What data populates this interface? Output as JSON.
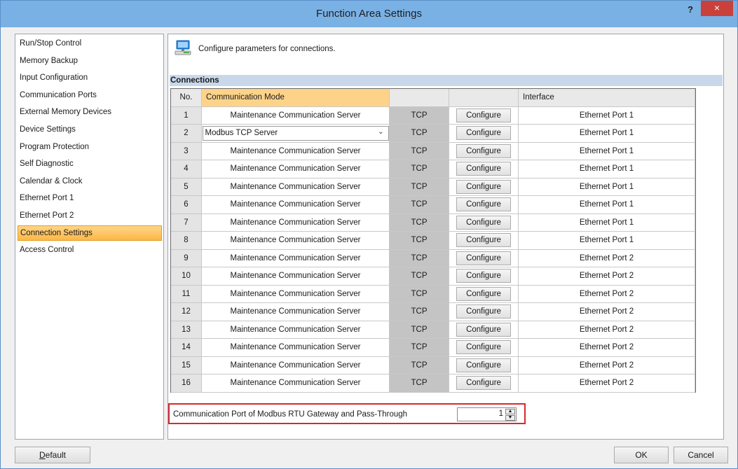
{
  "window": {
    "title": "Function Area Settings",
    "help": "?",
    "close": "×"
  },
  "sidebar": {
    "items": [
      "Run/Stop Control",
      "Memory Backup",
      "Input Configuration",
      "Communication Ports",
      "External Memory Devices",
      "Device Settings",
      "Program Protection",
      "Self Diagnostic",
      "Calendar & Clock",
      "Ethernet Port 1",
      "Ethernet Port 2",
      "Connection Settings",
      "Access Control"
    ],
    "selected_index": 11
  },
  "header": {
    "description": "Configure parameters for connections."
  },
  "connections": {
    "section_title": "Connections",
    "columns": {
      "no": "No.",
      "mode": "Communication Mode",
      "protocol": "",
      "configure": "",
      "interface": "Interface"
    },
    "rows": [
      {
        "no": "1",
        "mode": "Maintenance Communication Server",
        "protocol": "TCP",
        "configure": "Configure",
        "interface": "Ethernet Port 1"
      },
      {
        "no": "2",
        "mode": "Modbus TCP Server",
        "protocol": "TCP",
        "configure": "Configure",
        "interface": "Ethernet Port 1",
        "dropdown": true
      },
      {
        "no": "3",
        "mode": "Maintenance Communication Server",
        "protocol": "TCP",
        "configure": "Configure",
        "interface": "Ethernet Port 1"
      },
      {
        "no": "4",
        "mode": "Maintenance Communication Server",
        "protocol": "TCP",
        "configure": "Configure",
        "interface": "Ethernet Port 1"
      },
      {
        "no": "5",
        "mode": "Maintenance Communication Server",
        "protocol": "TCP",
        "configure": "Configure",
        "interface": "Ethernet Port 1"
      },
      {
        "no": "6",
        "mode": "Maintenance Communication Server",
        "protocol": "TCP",
        "configure": "Configure",
        "interface": "Ethernet Port 1"
      },
      {
        "no": "7",
        "mode": "Maintenance Communication Server",
        "protocol": "TCP",
        "configure": "Configure",
        "interface": "Ethernet Port 1"
      },
      {
        "no": "8",
        "mode": "Maintenance Communication Server",
        "protocol": "TCP",
        "configure": "Configure",
        "interface": "Ethernet Port 1"
      },
      {
        "no": "9",
        "mode": "Maintenance Communication Server",
        "protocol": "TCP",
        "configure": "Configure",
        "interface": "Ethernet Port 2"
      },
      {
        "no": "10",
        "mode": "Maintenance Communication Server",
        "protocol": "TCP",
        "configure": "Configure",
        "interface": "Ethernet Port 2"
      },
      {
        "no": "11",
        "mode": "Maintenance Communication Server",
        "protocol": "TCP",
        "configure": "Configure",
        "interface": "Ethernet Port 2"
      },
      {
        "no": "12",
        "mode": "Maintenance Communication Server",
        "protocol": "TCP",
        "configure": "Configure",
        "interface": "Ethernet Port 2"
      },
      {
        "no": "13",
        "mode": "Maintenance Communication Server",
        "protocol": "TCP",
        "configure": "Configure",
        "interface": "Ethernet Port 2"
      },
      {
        "no": "14",
        "mode": "Maintenance Communication Server",
        "protocol": "TCP",
        "configure": "Configure",
        "interface": "Ethernet Port 2"
      },
      {
        "no": "15",
        "mode": "Maintenance Communication Server",
        "protocol": "TCP",
        "configure": "Configure",
        "interface": "Ethernet Port 2"
      },
      {
        "no": "16",
        "mode": "Maintenance Communication Server",
        "protocol": "TCP",
        "configure": "Configure",
        "interface": "Ethernet Port 2"
      }
    ]
  },
  "gateway": {
    "label": "Communication Port of Modbus RTU Gateway and Pass-Through",
    "value": "1"
  },
  "footer": {
    "default_label_underlined": "D",
    "default_label_rest": "efault",
    "ok_label": "OK",
    "cancel_label": "Cancel"
  },
  "colors": {
    "titlebar": "#7ab1e4",
    "selected": "#fbb845",
    "highlight_box": "#d8282f"
  }
}
